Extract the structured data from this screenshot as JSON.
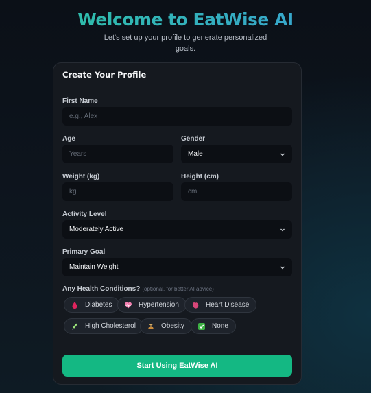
{
  "header": {
    "title": "Welcome to EatWise AI",
    "subtitle": "Let's set up your profile to generate personalized goals."
  },
  "form": {
    "title": "Create Your Profile",
    "first_name": {
      "label": "First Name",
      "placeholder": "e.g., Alex",
      "value": ""
    },
    "age": {
      "label": "Age",
      "placeholder": "Years",
      "value": ""
    },
    "gender": {
      "label": "Gender",
      "value": "Male"
    },
    "weight": {
      "label": "Weight (kg)",
      "placeholder": "kg",
      "value": ""
    },
    "height": {
      "label": "Height (cm)",
      "placeholder": "cm",
      "value": ""
    },
    "activity": {
      "label": "Activity Level",
      "value": "Moderately Active"
    },
    "goal": {
      "label": "Primary Goal",
      "value": "Maintain Weight"
    },
    "health": {
      "label": "Any Health Conditions?",
      "hint": "(optional, for better AI advice)",
      "options": [
        {
          "label": "Diabetes",
          "icon": "blood-drop-icon"
        },
        {
          "label": "Hypertension",
          "icon": "heart-pulse-icon"
        },
        {
          "label": "Heart Disease",
          "icon": "anatomical-heart-icon"
        },
        {
          "label": "High Cholesterol",
          "icon": "syringe-icon"
        },
        {
          "label": "Obesity",
          "icon": "weight-scale-icon"
        },
        {
          "label": "None",
          "icon": "check-box-icon"
        }
      ]
    },
    "submit_label": "Start Using EatWise AI"
  },
  "colors": {
    "accent": "#14b883",
    "title_gradient_start": "#2cc3a0",
    "title_gradient_end": "#3a9fd6",
    "card_bg": "#15191f",
    "input_bg": "#0c0f14"
  }
}
